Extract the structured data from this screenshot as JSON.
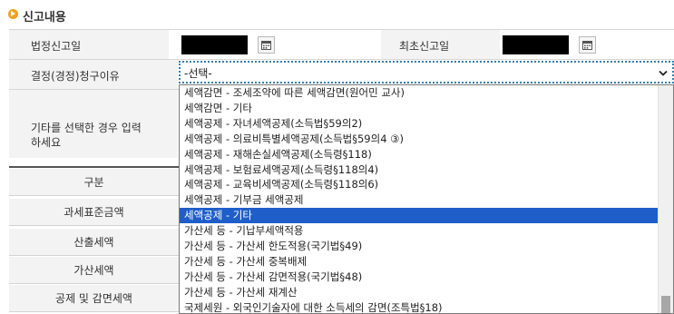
{
  "section": {
    "title": "신고내용"
  },
  "fields": {
    "filing_date_label": "법정신고일",
    "first_filing_label": "최초신고일",
    "reason_label": "결정(경정)청구이유",
    "other_label": "기타를 선택한 경우 입력\n하세요"
  },
  "select": {
    "value": "-선택-"
  },
  "dropdown": {
    "options": [
      "세액감면 - 조세조약에 따른 세액감면(원어민 교사)",
      "세액감면 - 기타",
      "세액공제 - 자녀세액공제(소득법§59의2)",
      "세액공제 - 의료비특별세액공제(소득법§59의4 ③)",
      "세액공제 - 재해손실세액공제(소득령§118)",
      "세액공제 - 보험료세액공제(소득령§118의4)",
      "세액공제 - 교육비세액공제(소득령§118의6)",
      "세액공제 - 기부금 세액공제",
      "세액공제 - 기타",
      "가산세 등 - 기납부세액적용",
      "가산세 등 - 가산세 한도적용(국기법§49)",
      "가산세 등 - 가산세 중복배제",
      "가산세 등 - 가산세 감면적용(국기법§48)",
      "가산세 등 - 가산세 재계산",
      "국제세원 - 외국인기술자에 대한 소득세의 감면(조특법§18)"
    ],
    "selected_option": "세액공제 - 기타"
  },
  "table": {
    "rows": [
      "구분",
      "과세표준금액",
      "산출세액",
      "가산세액",
      "공제 및 감면세액"
    ]
  },
  "colors": {
    "selection": "#1f5ec9",
    "focus_border": "#3a7fa8",
    "bullet": "#f0a020"
  }
}
